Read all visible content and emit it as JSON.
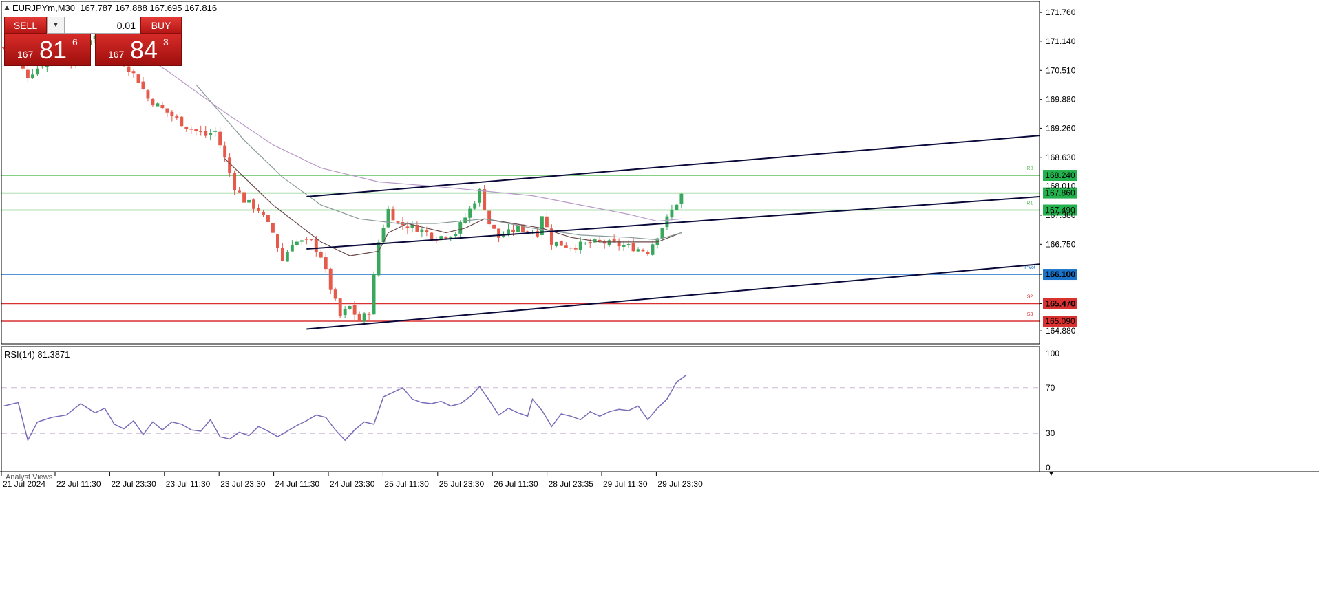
{
  "header": {
    "symbol": "EURJPYm,M30",
    "ohlc": "167.787 167.888 167.695 167.816"
  },
  "trade_panel": {
    "sell_label": "SELL",
    "buy_label": "BUY",
    "lot": "0.01",
    "sell_price": {
      "prefix": "167",
      "big": "81",
      "sup": "6"
    },
    "buy_price": {
      "prefix": "167",
      "big": "84",
      "sup": "3"
    }
  },
  "rsi_label": "RSI(14) 81.3871",
  "analyst_label": "Analyst Views",
  "colors": {
    "bull": "#3aa85c",
    "bear": "#e55a4a",
    "resistance": "#5fbf5f",
    "pivot": "#1a73c8",
    "support": "#d93030",
    "channel": "#0a0a3a",
    "ma_fast": "#6a4a4a",
    "ma_mid": "#8a9a9a",
    "ma_slow": "#b89ac8",
    "rsi": "#7a6ab8"
  },
  "chart_data": {
    "type": "candlestick",
    "symbol": "EURJPYm",
    "timeframe": "M30",
    "price_axis": {
      "ylim": [
        164.6,
        172.0
      ],
      "ticks": [
        "171.760",
        "171.140",
        "170.510",
        "169.880",
        "169.260",
        "168.630",
        "168.010",
        "167.380",
        "166.750",
        "166.100",
        "165.470",
        "164.880"
      ]
    },
    "time_axis": {
      "labels": [
        "21 Jul 2024",
        "22 Jul 11:30",
        "22 Jul 23:30",
        "23 Jul 11:30",
        "23 Jul 23:30",
        "24 Jul 11:30",
        "24 Jul 23:30",
        "25 Jul 11:30",
        "25 Jul 23:30",
        "26 Jul 11:30",
        "28 Jul 23:35",
        "29 Jul 11:30",
        "29 Jul 23:30"
      ]
    },
    "close_path": [
      [
        0,
        171.0
      ],
      [
        5,
        170.4
      ],
      [
        10,
        170.8
      ],
      [
        14,
        170.7
      ],
      [
        18,
        171.2
      ],
      [
        22,
        171.1
      ],
      [
        24,
        170.8
      ],
      [
        28,
        170.3
      ],
      [
        30,
        169.9
      ],
      [
        34,
        169.6
      ],
      [
        38,
        169.3
      ],
      [
        42,
        169.1
      ],
      [
        44,
        169.2
      ],
      [
        46,
        168.6
      ],
      [
        48,
        168.0
      ],
      [
        50,
        167.7
      ],
      [
        53,
        167.5
      ],
      [
        56,
        167.0
      ],
      [
        58,
        166.4
      ],
      [
        60,
        166.8
      ],
      [
        64,
        166.8
      ],
      [
        66,
        166.5
      ],
      [
        68,
        165.8
      ],
      [
        70,
        165.2
      ],
      [
        72,
        165.4
      ],
      [
        74,
        165.1
      ],
      [
        76,
        165.3
      ],
      [
        78,
        166.8
      ],
      [
        80,
        167.5
      ],
      [
        82,
        167.2
      ],
      [
        86,
        167.1
      ],
      [
        90,
        166.9
      ],
      [
        94,
        167.0
      ],
      [
        97,
        167.5
      ],
      [
        99,
        167.9
      ],
      [
        101,
        167.2
      ],
      [
        103,
        166.9
      ],
      [
        107,
        167.1
      ],
      [
        111,
        167.0
      ],
      [
        112,
        167.4
      ],
      [
        114,
        166.8
      ],
      [
        118,
        166.7
      ],
      [
        124,
        166.8
      ],
      [
        130,
        166.7
      ],
      [
        134,
        166.6
      ],
      [
        138,
        167.3
      ],
      [
        141,
        167.82
      ]
    ],
    "horizontal_levels": [
      {
        "label": "168.240",
        "value": 168.24,
        "kind": "resistance",
        "tag": "R3"
      },
      {
        "label": "167.860",
        "value": 167.86,
        "kind": "resistance",
        "tag": ""
      },
      {
        "label": "167.490",
        "value": 167.49,
        "kind": "resistance",
        "tag": "R1"
      },
      {
        "label": "166.100",
        "value": 166.1,
        "kind": "pivot",
        "tag": "Pivot"
      },
      {
        "label": "165.470",
        "value": 165.47,
        "kind": "support",
        "tag": "S2"
      },
      {
        "label": "165.090",
        "value": 165.09,
        "kind": "support",
        "tag": "S3"
      }
    ],
    "trend_lines": [
      {
        "name": "upper",
        "from": [
          63,
          167.78
        ],
        "to": [
          216,
          169.1
        ]
      },
      {
        "name": "middle",
        "from": [
          63,
          166.65
        ],
        "to": [
          216,
          167.78
        ]
      },
      {
        "name": "lower",
        "from": [
          63,
          164.92
        ],
        "to": [
          216,
          166.32
        ]
      }
    ],
    "moving_averages": [
      {
        "name": "ma_fast",
        "points": [
          [
            46,
            168.6
          ],
          [
            56,
            167.6
          ],
          [
            66,
            166.8
          ],
          [
            72,
            166.5
          ],
          [
            78,
            166.6
          ],
          [
            80,
            167.0
          ],
          [
            84,
            167.2
          ],
          [
            88,
            167.1
          ],
          [
            92,
            167.0
          ],
          [
            96,
            167.1
          ],
          [
            100,
            167.3
          ],
          [
            106,
            167.2
          ],
          [
            112,
            167.1
          ],
          [
            118,
            166.9
          ],
          [
            124,
            166.8
          ],
          [
            130,
            166.8
          ],
          [
            136,
            166.8
          ],
          [
            141,
            167.0
          ]
        ]
      },
      {
        "name": "ma_mid",
        "points": [
          [
            40,
            170.2
          ],
          [
            50,
            169.0
          ],
          [
            58,
            168.2
          ],
          [
            66,
            167.6
          ],
          [
            74,
            167.3
          ],
          [
            82,
            167.2
          ],
          [
            90,
            167.2
          ],
          [
            100,
            167.3
          ],
          [
            110,
            167.1
          ],
          [
            120,
            166.95
          ],
          [
            130,
            166.9
          ],
          [
            136,
            166.85
          ],
          [
            141,
            167.0
          ]
        ]
      },
      {
        "name": "ma_slow",
        "points": [
          [
            22,
            171.3
          ],
          [
            34,
            170.5
          ],
          [
            46,
            169.6
          ],
          [
            56,
            168.9
          ],
          [
            66,
            168.4
          ],
          [
            78,
            168.1
          ],
          [
            90,
            168.0
          ],
          [
            100,
            167.9
          ],
          [
            110,
            167.8
          ],
          [
            120,
            167.6
          ],
          [
            130,
            167.4
          ],
          [
            136,
            167.25
          ],
          [
            141,
            167.3
          ]
        ]
      }
    ],
    "rsi": {
      "period": 14,
      "value": 81.3871,
      "ylim": [
        0,
        100
      ],
      "ticks": [
        "100",
        "70",
        "30",
        "0"
      ],
      "levels": [
        70,
        30
      ],
      "values": [
        [
          0,
          54
        ],
        [
          3,
          57
        ],
        [
          5,
          24
        ],
        [
          7,
          40
        ],
        [
          10,
          44
        ],
        [
          13,
          46
        ],
        [
          16,
          56
        ],
        [
          19,
          48
        ],
        [
          21,
          52
        ],
        [
          23,
          38
        ],
        [
          25,
          34
        ],
        [
          27,
          41
        ],
        [
          29,
          29
        ],
        [
          31,
          40
        ],
        [
          33,
          33
        ],
        [
          35,
          40
        ],
        [
          37,
          38
        ],
        [
          39,
          33
        ],
        [
          41,
          32
        ],
        [
          43,
          42
        ],
        [
          45,
          27
        ],
        [
          47,
          25
        ],
        [
          49,
          31
        ],
        [
          51,
          28
        ],
        [
          53,
          36
        ],
        [
          55,
          32
        ],
        [
          57,
          27
        ],
        [
          59,
          32
        ],
        [
          61,
          37
        ],
        [
          63,
          41
        ],
        [
          65,
          46
        ],
        [
          67,
          44
        ],
        [
          69,
          33
        ],
        [
          71,
          24
        ],
        [
          73,
          33
        ],
        [
          75,
          40
        ],
        [
          77,
          38
        ],
        [
          79,
          62
        ],
        [
          81,
          66
        ],
        [
          83,
          70
        ],
        [
          85,
          60
        ],
        [
          87,
          57
        ],
        [
          89,
          56
        ],
        [
          91,
          58
        ],
        [
          93,
          54
        ],
        [
          95,
          56
        ],
        [
          97,
          62
        ],
        [
          99,
          71
        ],
        [
          101,
          59
        ],
        [
          103,
          46
        ],
        [
          105,
          52
        ],
        [
          107,
          48
        ],
        [
          109,
          45
        ],
        [
          110,
          60
        ],
        [
          112,
          50
        ],
        [
          114,
          36
        ],
        [
          116,
          47
        ],
        [
          118,
          45
        ],
        [
          120,
          42
        ],
        [
          122,
          49
        ],
        [
          124,
          45
        ],
        [
          126,
          49
        ],
        [
          128,
          51
        ],
        [
          130,
          50
        ],
        [
          132,
          54
        ],
        [
          134,
          42
        ],
        [
          136,
          52
        ],
        [
          138,
          60
        ],
        [
          140,
          75
        ],
        [
          142,
          81
        ]
      ]
    }
  }
}
